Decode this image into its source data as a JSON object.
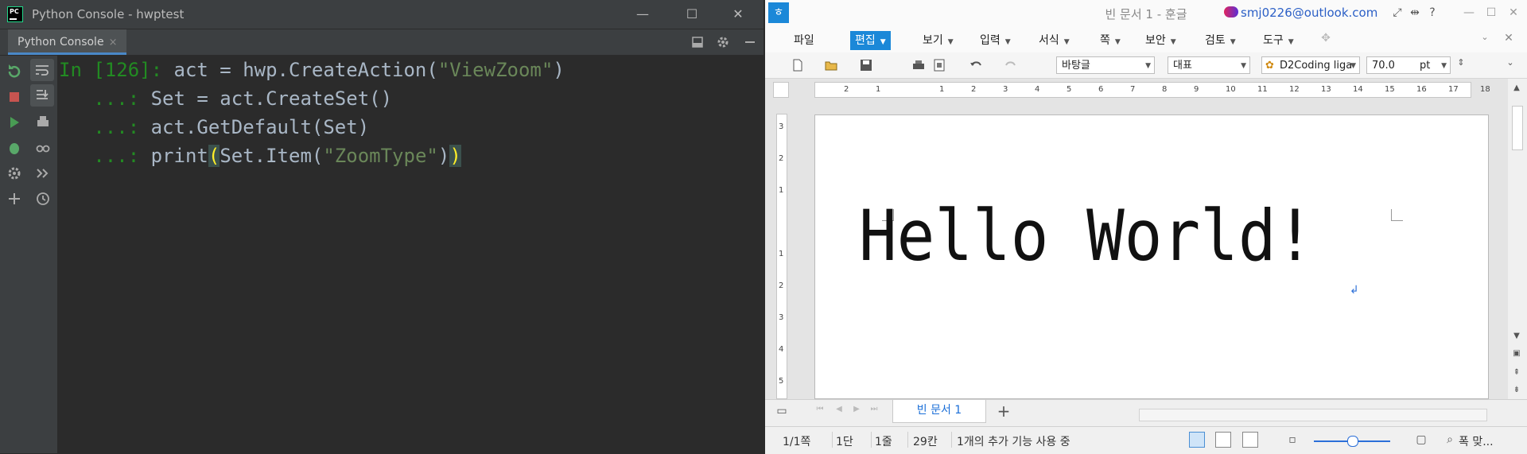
{
  "pycharm": {
    "window_title": "Python Console - hwptest",
    "tab_label": "Python Console",
    "tab_close": "×",
    "controls": {
      "minimize": "—",
      "maximize": "☐",
      "close": "✕"
    },
    "code": [
      {
        "prompt": "In [126]:",
        "before": " act = hwp.CreateAction(",
        "str": "\"ViewZoom\"",
        "after": ")"
      },
      {
        "prompt": "   ...:",
        "text": " Set = act.CreateSet()"
      },
      {
        "prompt": "   ...:",
        "text": " act.GetDefault(Set)"
      },
      {
        "prompt": "   ...:",
        "before": " print",
        "paren_open": "(",
        "mid": "Set.Item(",
        "str": "\"ZoomType\"",
        "close1": ")",
        "paren_close": ")"
      }
    ]
  },
  "hangul": {
    "logo": "ㅎ",
    "doc_title": "빈 문서 1 - 훈글",
    "account": "smj0226@outlook.com",
    "help": "?",
    "menus": [
      {
        "label": "파일"
      },
      {
        "label": "편집",
        "active": true
      },
      {
        "label": "보기"
      },
      {
        "label": "입력"
      },
      {
        "label": "서식"
      },
      {
        "label": "쪽"
      },
      {
        "label": "보안"
      },
      {
        "label": "검토"
      },
      {
        "label": "도구"
      }
    ],
    "style_combo": "바탕글",
    "lang_combo": "대표",
    "font_combo": "D2Coding liga",
    "size_value": "70.0",
    "size_unit": "pt",
    "ruler_h": [
      "2",
      "1",
      "",
      "1",
      "2",
      "3",
      "4",
      "5",
      "6",
      "7",
      "8",
      "9",
      "10",
      "11",
      "12",
      "13",
      "14",
      "15",
      "16",
      "17",
      "18"
    ],
    "ruler_v": [
      "3",
      "2",
      "1",
      "",
      "1",
      "2",
      "3",
      "4",
      "5"
    ],
    "document_text": "Hello World!",
    "para_mark": "↲",
    "doc_tab": "빈 문서 1",
    "add_tab": "+",
    "status": {
      "page": "1/1쪽",
      "section": "1단",
      "line": "1줄",
      "column": "29칸",
      "addons": "1개의 추가 기능 사용 중",
      "zoom_label": "폭 맞..."
    },
    "colors": {
      "accent": "#1b88d8",
      "link": "#2b5fc6"
    }
  }
}
